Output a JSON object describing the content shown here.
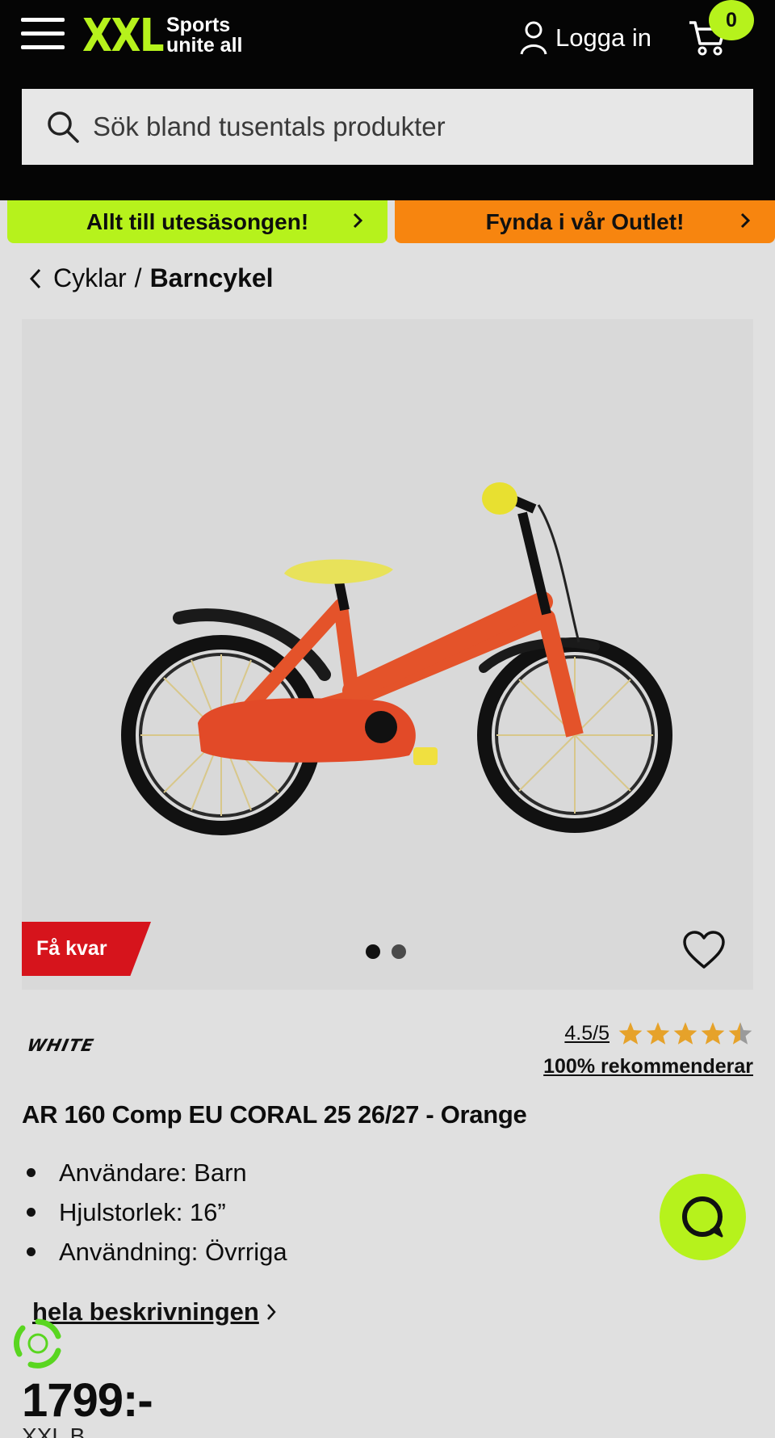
{
  "header": {
    "logo_text": "XXL",
    "logo_tagline_1": "Sports",
    "logo_tagline_2": "unite all",
    "login_label": "Logga in",
    "cart_count": "0",
    "search_placeholder": "Sök bland tusentals produkter",
    "colors": {
      "background": "#050505",
      "accent": "#b6f21c"
    }
  },
  "banners": [
    {
      "label": "Allt till utesäsongen!",
      "color": "#b6f21c"
    },
    {
      "label": "Fynda i vår Outlet!",
      "color": "#f7850f"
    }
  ],
  "breadcrumb": {
    "parent": "Cyklar",
    "separator": "/",
    "current": "Barncykel"
  },
  "gallery": {
    "badge": "Få kvar",
    "badge_color": "#d6141c",
    "image_count": 2,
    "active_index": 0
  },
  "product": {
    "brand": "WHITE",
    "rating": "4.5/5",
    "rating_value": 4.5,
    "rating_max": 5,
    "recommend": "100% rekommenderar",
    "title": "AR 160 Comp EU CORAL 25 26/27 - Orange",
    "specs": [
      "Användare: Barn",
      "Hjulstorlek: 16”",
      "Användning: Övrriga"
    ],
    "description_link": "hela beskrivningen",
    "price": "1799:-",
    "under_price_partial": "XXL B"
  },
  "icons": [
    "menu-icon",
    "user-icon",
    "cart-icon",
    "search-icon",
    "chevron-right-icon",
    "chevron-left-icon",
    "heart-icon",
    "star-icon",
    "chat-icon",
    "recycle-icon"
  ]
}
